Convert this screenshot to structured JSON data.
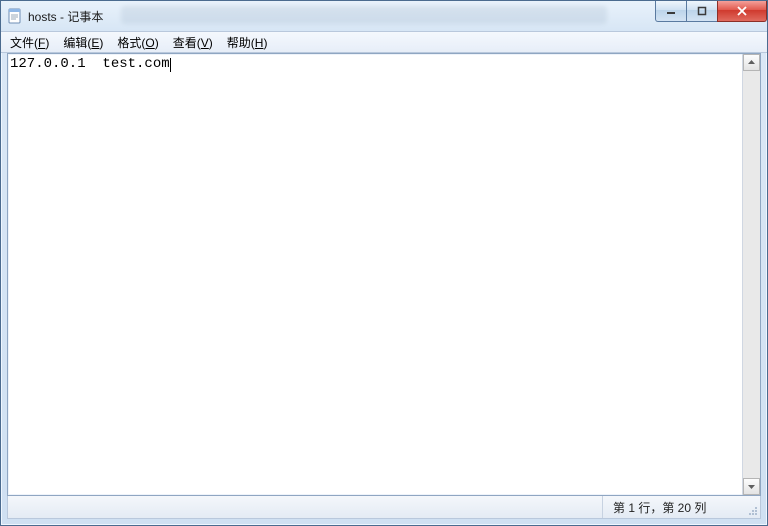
{
  "window": {
    "title": "hosts - 记事本"
  },
  "menu": {
    "file": {
      "label": "文件",
      "accel": "F"
    },
    "edit": {
      "label": "编辑",
      "accel": "E"
    },
    "format": {
      "label": "格式",
      "accel": "O"
    },
    "view": {
      "label": "查看",
      "accel": "V"
    },
    "help": {
      "label": "帮助",
      "accel": "H"
    }
  },
  "editor": {
    "content": "127.0.0.1  test.com"
  },
  "status": {
    "position": "第 1 行，第 20 列"
  },
  "icons": {
    "app": "notepad-icon",
    "minimize": "minimize-icon",
    "maximize": "maximize-icon",
    "close": "close-icon",
    "scroll_up": "chevron-up-icon",
    "scroll_down": "chevron-down-icon",
    "resize_grip": "resize-grip-icon"
  }
}
